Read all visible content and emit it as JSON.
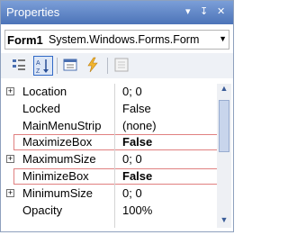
{
  "window": {
    "title": "Properties",
    "pin_glyph": "↧",
    "close_glyph": "✕",
    "menu_glyph": "▾"
  },
  "object_selector": {
    "name": "Form1",
    "type": "System.Windows.Forms.Form",
    "dropdown_icon": "chevron-down-icon"
  },
  "toolbar": {
    "buttons": [
      "categorized-icon",
      "alphabetical-icon",
      "properties-icon",
      "events-icon",
      "property-pages-icon"
    ]
  },
  "grid": {
    "rows": [
      {
        "name": "Location",
        "value": "0; 0",
        "expandable": true,
        "highlighted": false
      },
      {
        "name": "Locked",
        "value": "False",
        "expandable": false,
        "highlighted": false
      },
      {
        "name": "MainMenuStrip",
        "value": "(none)",
        "expandable": false,
        "highlighted": false
      },
      {
        "name": "MaximizeBox",
        "value": "False",
        "expandable": false,
        "highlighted": true
      },
      {
        "name": "MaximumSize",
        "value": "0; 0",
        "expandable": true,
        "highlighted": false
      },
      {
        "name": "MinimizeBox",
        "value": "False",
        "expandable": false,
        "highlighted": true
      },
      {
        "name": "MinimumSize",
        "value": "0; 0",
        "expandable": true,
        "highlighted": false
      },
      {
        "name": "Opacity",
        "value": "100%",
        "expandable": false,
        "highlighted": false
      }
    ]
  },
  "colors": {
    "title_bar": "#5a80c4",
    "highlight_border": "#e08080"
  }
}
